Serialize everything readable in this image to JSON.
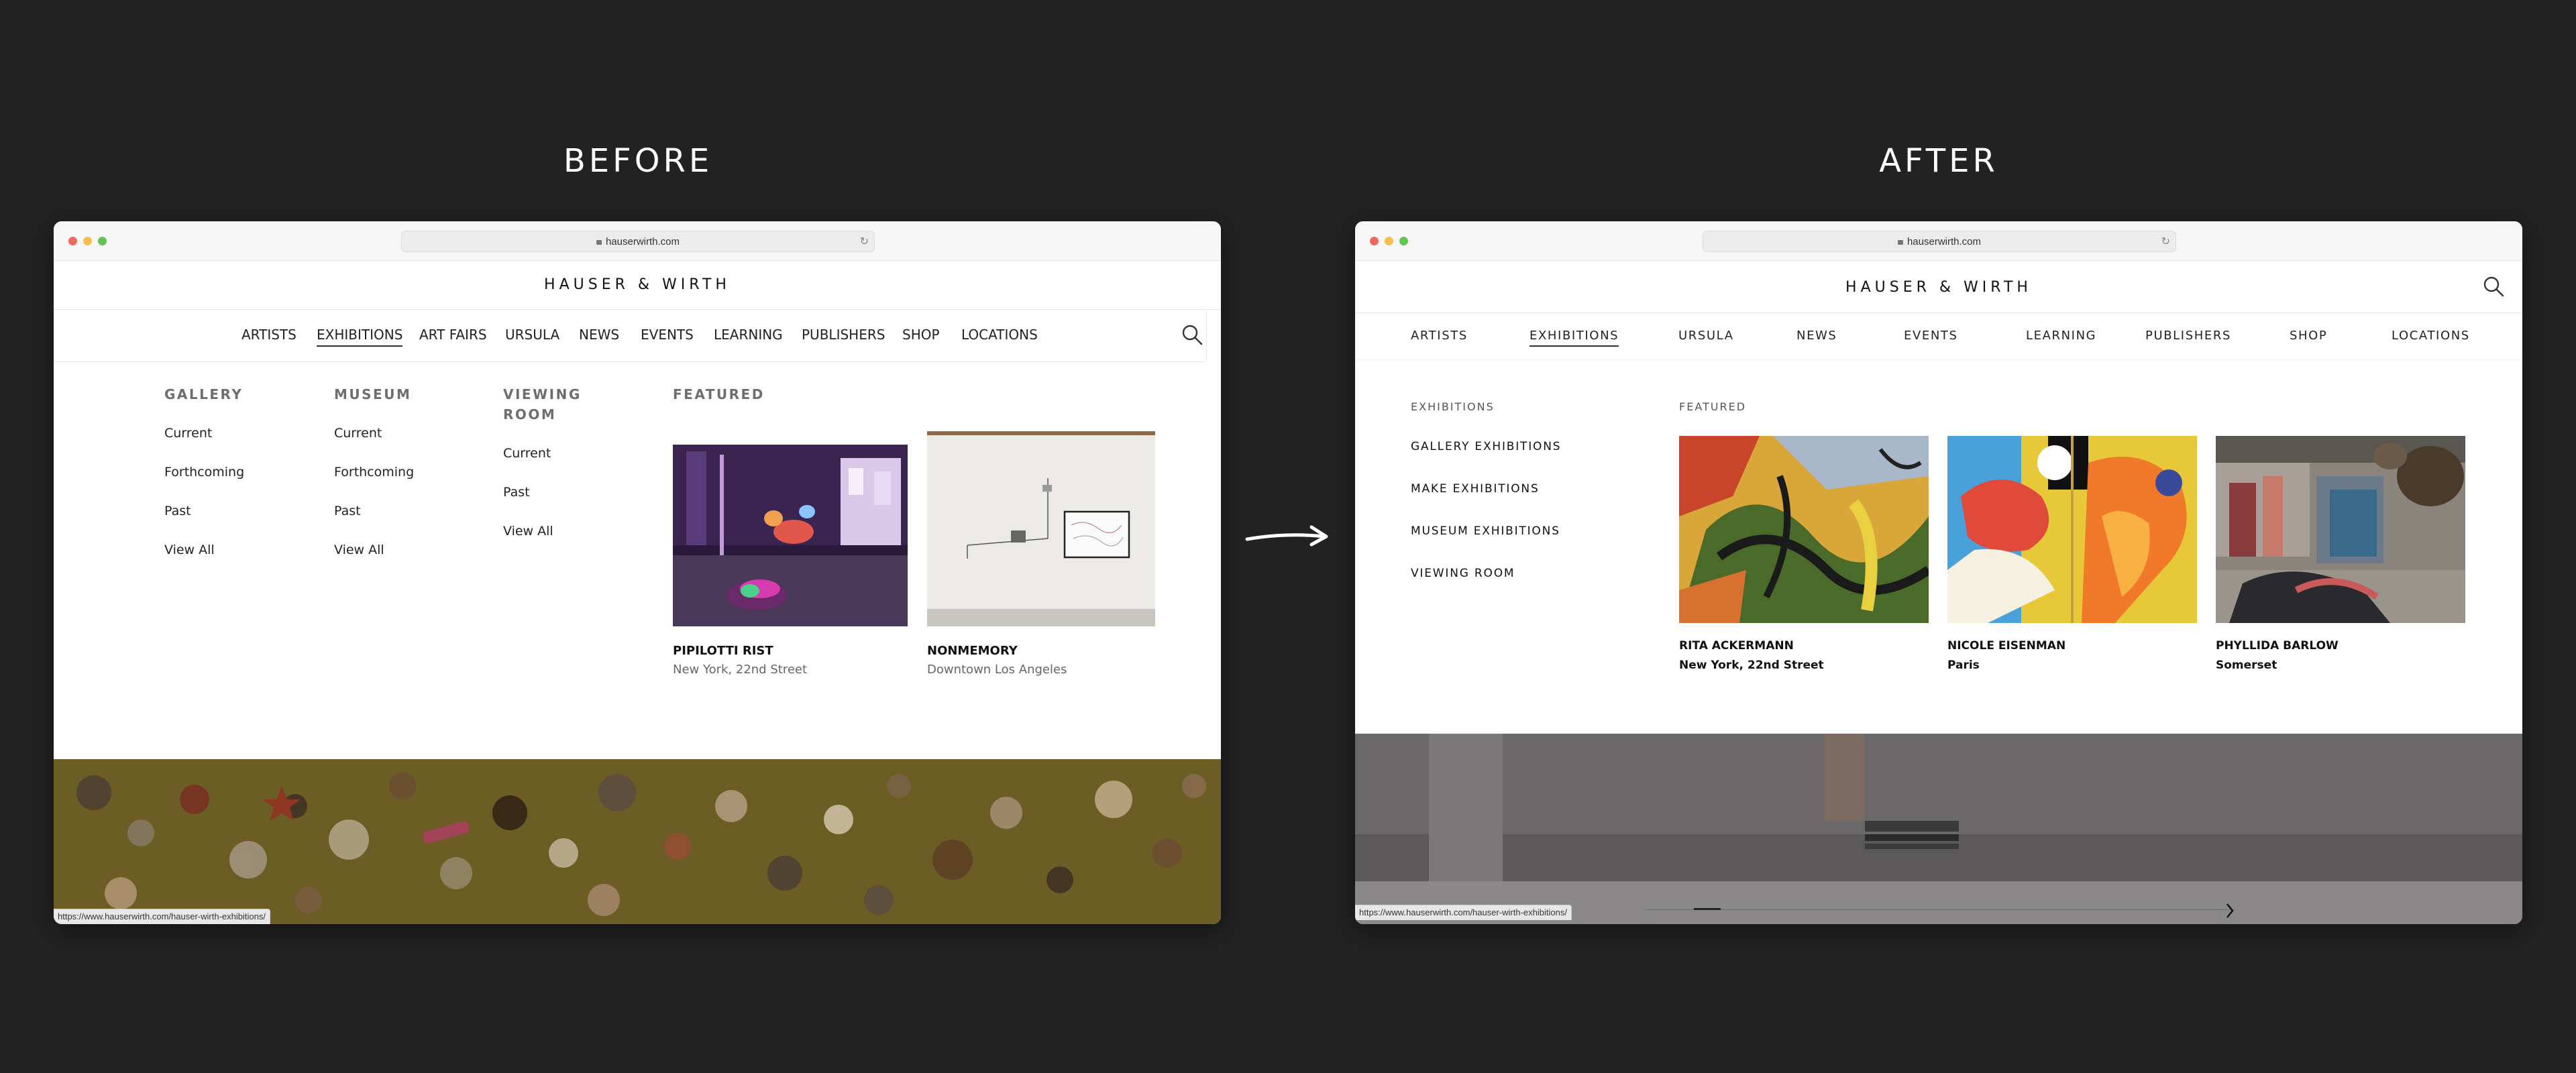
{
  "comparison": {
    "before_label": "BEFORE",
    "after_label": "AFTER"
  },
  "before": {
    "url": "hauserwirth.com",
    "logo": "HAUSER & WIRTH",
    "nav": [
      "ARTISTS",
      "EXHIBITIONS",
      "ART FAIRS",
      "URSULA",
      "NEWS",
      "EVENTS",
      "LEARNING",
      "PUBLISHERS",
      "SHOP",
      "LOCATIONS"
    ],
    "active_nav": "EXHIBITIONS",
    "columns": [
      {
        "heading": "GALLERY",
        "links": [
          "Current",
          "Forthcoming",
          "Past",
          "View All"
        ]
      },
      {
        "heading": "MUSEUM",
        "links": [
          "Current",
          "Forthcoming",
          "Past",
          "View All"
        ]
      },
      {
        "heading_line1": "VIEWING",
        "heading_line2": "ROOM",
        "links": [
          "Current",
          "Past",
          "View All"
        ]
      }
    ],
    "featured_heading": "FEATURED",
    "featured": [
      {
        "title": "PIPILOTTI RIST",
        "subtitle": "New York, 22nd Street"
      },
      {
        "title": "NONMEMORY",
        "subtitle": "Downtown Los Angeles"
      }
    ],
    "status_url": "https://www.hauserwirth.com/hauser-wirth-exhibitions/"
  },
  "after": {
    "url": "hauserwirth.com",
    "logo": "HAUSER & WIRTH",
    "nav": [
      "ARTISTS",
      "EXHIBITIONS",
      "URSULA",
      "NEWS",
      "EVENTS",
      "LEARNING",
      "PUBLISHERS",
      "SHOP",
      "LOCATIONS"
    ],
    "active_nav": "EXHIBITIONS",
    "menu_heading": "EXHIBITIONS",
    "menu_links": [
      "GALLERY EXHIBITIONS",
      "MAKE EXHIBITIONS",
      "MUSEUM EXHIBITIONS",
      "VIEWING ROOM"
    ],
    "featured_heading": "FEATURED",
    "featured": [
      {
        "title": "RITA ACKERMANN",
        "subtitle": "New York, 22nd Street"
      },
      {
        "title": "NICOLE EISENMAN",
        "subtitle": "Paris"
      },
      {
        "title": "PHYLLIDA BARLOW",
        "subtitle": "Somerset"
      }
    ],
    "status_url": "https://www.hauserwirth.com/hauser-wirth-exhibitions/"
  },
  "icons": {
    "search": "search-icon",
    "arrow": "arrow-right-icon",
    "slider_prev": "chevron-left-icon",
    "slider_next": "chevron-right-icon"
  },
  "colors": {
    "background": "#222222",
    "traffic_red": "#ed6a5e",
    "traffic_yellow": "#f5bf4f",
    "traffic_green": "#61c554"
  }
}
